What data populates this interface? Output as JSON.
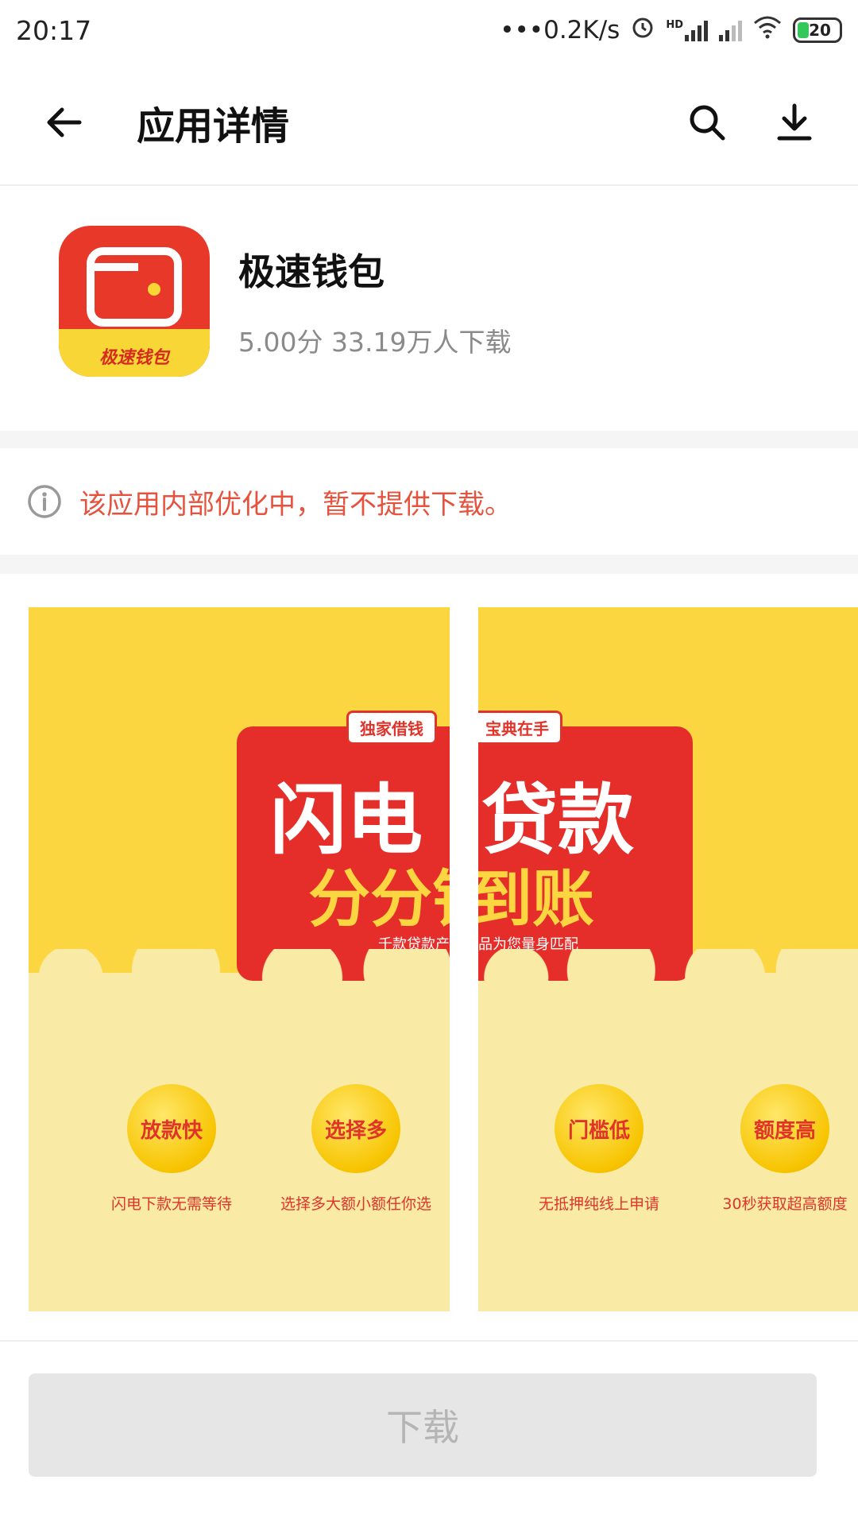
{
  "status_bar": {
    "time": "20:17",
    "network_speed": "•••0.2K/s",
    "hd_label": "HD",
    "battery": "20"
  },
  "header": {
    "title": "应用详情",
    "back_icon": "arrow-left-icon",
    "search_icon": "search-icon",
    "download_icon": "download-icon"
  },
  "app": {
    "name": "极速钱包",
    "icon_label": "极速钱包",
    "rating_downloads": "5.00分 33.19万人下载"
  },
  "notice": {
    "text": "该应用内部优化中，暂不提供下载。",
    "icon": "info-icon",
    "color": "#e5533e"
  },
  "screenshots": [
    {
      "tag": "独家借钱",
      "headline": "闪电",
      "subline": "分分钟",
      "small": "千款贷款产",
      "features": [
        {
          "coin": "放款快",
          "caption": "闪电下款无需等待"
        },
        {
          "coin": "选择多",
          "caption": "选择多大额小额任你选"
        }
      ]
    },
    {
      "tag": "宝典在手",
      "headline": "贷款",
      "subline": "到账",
      "small": "品为您量身匹配",
      "features": [
        {
          "coin": "门槛低",
          "caption": "无抵押纯线上申请"
        },
        {
          "coin": "额度高",
          "caption": "30秒获取超高额度"
        }
      ]
    }
  ],
  "bottom": {
    "download_label": "下载"
  }
}
